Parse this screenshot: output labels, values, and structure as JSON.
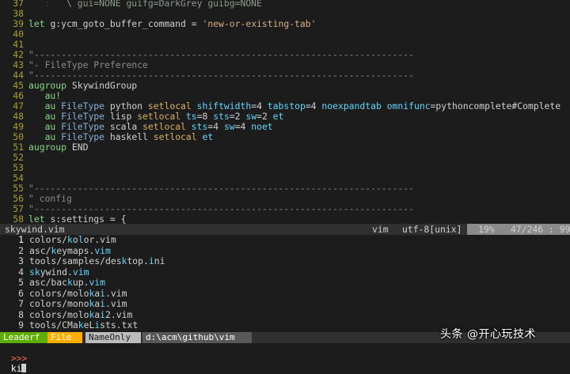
{
  "editor": {
    "lines": [
      {
        "n": "37",
        "parts": [
          {
            "c": "guide",
            "t": "   : "
          },
          {
            "c": "dim",
            "t": "  \\ gui=NONE guifg=DarkGrey guibg=NONE"
          }
        ]
      },
      {
        "n": "38",
        "parts": []
      },
      {
        "n": "39",
        "parts": [
          {
            "c": "kw",
            "t": "let "
          },
          {
            "c": "tx",
            "t": "g:ycm_goto_buffer_command = "
          },
          {
            "c": "str",
            "t": "'new-or-existing-tab'"
          }
        ]
      },
      {
        "n": "40",
        "parts": []
      },
      {
        "n": "41",
        "parts": []
      },
      {
        "n": "42",
        "parts": [
          {
            "c": "cm",
            "t": "\"----------------------------------------------------------------------"
          }
        ]
      },
      {
        "n": "43",
        "parts": [
          {
            "c": "cm",
            "t": "\"- FileType Preference"
          }
        ]
      },
      {
        "n": "44",
        "parts": [
          {
            "c": "cm",
            "t": "\"----------------------------------------------------------------------"
          }
        ]
      },
      {
        "n": "45",
        "parts": [
          {
            "c": "kw",
            "t": "augroup "
          },
          {
            "c": "tx",
            "t": "SkywindGroup"
          }
        ]
      },
      {
        "n": "46",
        "parts": [
          {
            "c": "guide",
            "t": "   "
          },
          {
            "c": "kw",
            "t": "au!"
          }
        ]
      },
      {
        "n": "47",
        "parts": [
          {
            "c": "guide",
            "t": "   "
          },
          {
            "c": "kw",
            "t": "au "
          },
          {
            "c": "ty",
            "t": "FileType "
          },
          {
            "c": "tx",
            "t": "python "
          },
          {
            "c": "kw2",
            "t": "setlocal "
          },
          {
            "c": "nr",
            "t": "shiftwidth"
          },
          {
            "c": "tx",
            "t": "=4 "
          },
          {
            "c": "nr",
            "t": "tabstop"
          },
          {
            "c": "tx",
            "t": "=4 "
          },
          {
            "c": "nr",
            "t": "noexpandtab omnifunc"
          },
          {
            "c": "tx",
            "t": "=pythoncomplete#Complete"
          }
        ]
      },
      {
        "n": "48",
        "parts": [
          {
            "c": "guide",
            "t": "   "
          },
          {
            "c": "kw",
            "t": "au "
          },
          {
            "c": "ty",
            "t": "FileType "
          },
          {
            "c": "tx",
            "t": "lisp "
          },
          {
            "c": "kw2",
            "t": "setlocal "
          },
          {
            "c": "nr",
            "t": "ts"
          },
          {
            "c": "tx",
            "t": "=8 "
          },
          {
            "c": "nr",
            "t": "sts"
          },
          {
            "c": "tx",
            "t": "=2 "
          },
          {
            "c": "nr",
            "t": "sw"
          },
          {
            "c": "tx",
            "t": "=2 "
          },
          {
            "c": "nr",
            "t": "et"
          }
        ]
      },
      {
        "n": "49",
        "parts": [
          {
            "c": "guide",
            "t": "   "
          },
          {
            "c": "kw",
            "t": "au "
          },
          {
            "c": "ty",
            "t": "FileType "
          },
          {
            "c": "tx",
            "t": "scala "
          },
          {
            "c": "kw2",
            "t": "setlocal "
          },
          {
            "c": "nr",
            "t": "sts"
          },
          {
            "c": "tx",
            "t": "=4 "
          },
          {
            "c": "nr",
            "t": "sw"
          },
          {
            "c": "tx",
            "t": "=4 "
          },
          {
            "c": "nr",
            "t": "noet"
          }
        ]
      },
      {
        "n": "50",
        "parts": [
          {
            "c": "guide",
            "t": "   "
          },
          {
            "c": "kw",
            "t": "au "
          },
          {
            "c": "ty",
            "t": "FileType "
          },
          {
            "c": "tx",
            "t": "haskell "
          },
          {
            "c": "kw2",
            "t": "setlocal "
          },
          {
            "c": "nr",
            "t": "et"
          }
        ]
      },
      {
        "n": "51",
        "parts": [
          {
            "c": "kw",
            "t": "augroup "
          },
          {
            "c": "tx",
            "t": "END"
          }
        ]
      },
      {
        "n": "52",
        "parts": []
      },
      {
        "n": "53",
        "parts": []
      },
      {
        "n": "54",
        "parts": []
      },
      {
        "n": "55",
        "parts": [
          {
            "c": "cm",
            "t": "\"----------------------------------------------------------------------"
          }
        ]
      },
      {
        "n": "56",
        "parts": [
          {
            "c": "cm",
            "t": "\" config"
          }
        ]
      },
      {
        "n": "57",
        "parts": [
          {
            "c": "cm",
            "t": "\"----------------------------------------------------------------------"
          }
        ]
      },
      {
        "n": "58",
        "parts": [
          {
            "c": "kw",
            "t": "let "
          },
          {
            "c": "tx",
            "t": "s:settings = {"
          }
        ]
      }
    ]
  },
  "status": {
    "filename": "skywind.vim",
    "filetype": "vim",
    "encoding": "utf-8[unix]",
    "percent": "19%",
    "position": "47/246 : 99"
  },
  "results": [
    {
      "n": "1",
      "pre": "colors/",
      "hl": "k",
      "mid": "o",
      "hl2": "l",
      "rest": "or.vim"
    },
    {
      "n": "2",
      "pre": "asc/",
      "hl": "k",
      "mid": "eymaps.",
      "hl2": "vim",
      "rest": ""
    },
    {
      "n": "3",
      "pre": "tools/samples/des",
      "hl": "k",
      "mid": "top.",
      "hl2": "i",
      "rest": "ni"
    },
    {
      "n": "4",
      "pre": "",
      "hl": "sk",
      "mid": "ywind.",
      "hl2": "vim",
      "rest": ""
    },
    {
      "n": "5",
      "pre": "asc/bac",
      "hl": "k",
      "mid": "up.",
      "hl2": "vim",
      "rest": ""
    },
    {
      "n": "6",
      "pre": "colors/molo",
      "hl": "k",
      "mid": "a",
      "hl2": "i",
      "rest": ".vim"
    },
    {
      "n": "7",
      "pre": "colors/mono",
      "hl": "k",
      "mid": "a",
      "hl2": "i",
      "rest": ".vim"
    },
    {
      "n": "8",
      "pre": "colors/molo",
      "hl": "k",
      "mid": "a",
      "hl2": "i",
      "rest": "2.vim"
    },
    {
      "n": "9",
      "pre": "tools/CMa",
      "hl": "k",
      "mid": "eL",
      "hl2": "i",
      "rest": "sts.txt"
    }
  ],
  "leaderf": {
    "mode": "Leaderf",
    "category": "File",
    "match_mode": "NameOnly",
    "cwd": "d:\\acm\\github\\vim"
  },
  "prompt": {
    "symbol": ">>>",
    "input": "ki"
  },
  "watermark": "头条 @开心玩技术"
}
